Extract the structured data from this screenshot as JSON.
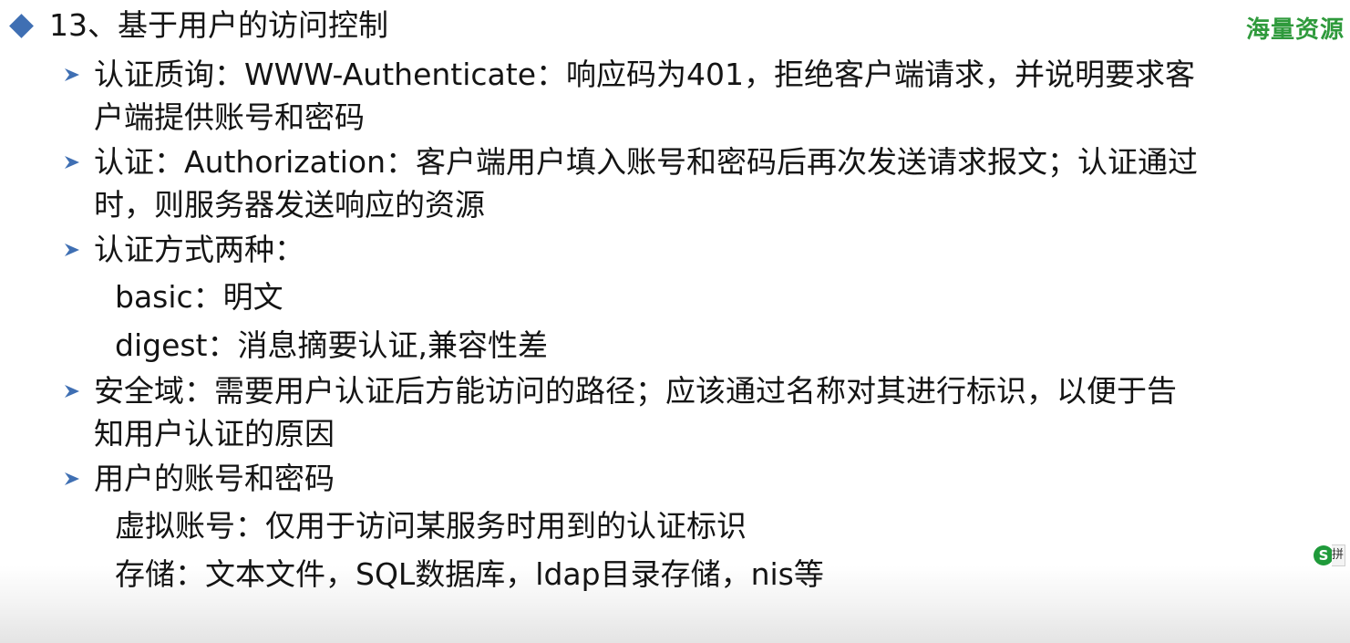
{
  "title": "13、基于用户的访问控制",
  "watermark": "海量资源",
  "bullets": [
    {
      "lines": [
        "认证质询：WWW-Authenticate：响应码为401，拒绝客户端请求，并说明要求客",
        "户端提供账号和密码"
      ],
      "subs": []
    },
    {
      "lines": [
        "认证：Authorization：客户端用户填入账号和密码后再次发送请求报文；认证通过",
        "时，则服务器发送响应的资源"
      ],
      "subs": []
    },
    {
      "lines": [
        "认证方式两种："
      ],
      "subs": [
        "basic：明文",
        "digest：消息摘要认证,兼容性差"
      ]
    },
    {
      "lines": [
        "安全域：需要用户认证后方能访问的路径；应该通过名称对其进行标识，以便于告",
        "知用户认证的原因"
      ],
      "subs": []
    },
    {
      "lines": [
        "用户的账号和密码"
      ],
      "subs": [
        "虚拟账号：仅用于访问某服务时用到的认证标识",
        "存储：文本文件，SQL数据库，ldap目录存储，nis等"
      ]
    }
  ],
  "side_icon": {
    "glyph": "S",
    "tail": "拼"
  },
  "colors": {
    "diamond": "#3f6fb3",
    "arrow": "#3f6fb3",
    "watermark": "#2f9a3c"
  },
  "icons": {
    "title_marker": "diamond-bullet-icon",
    "item_marker": "arrow-bullet-icon",
    "side": "sogou-input-icon"
  }
}
